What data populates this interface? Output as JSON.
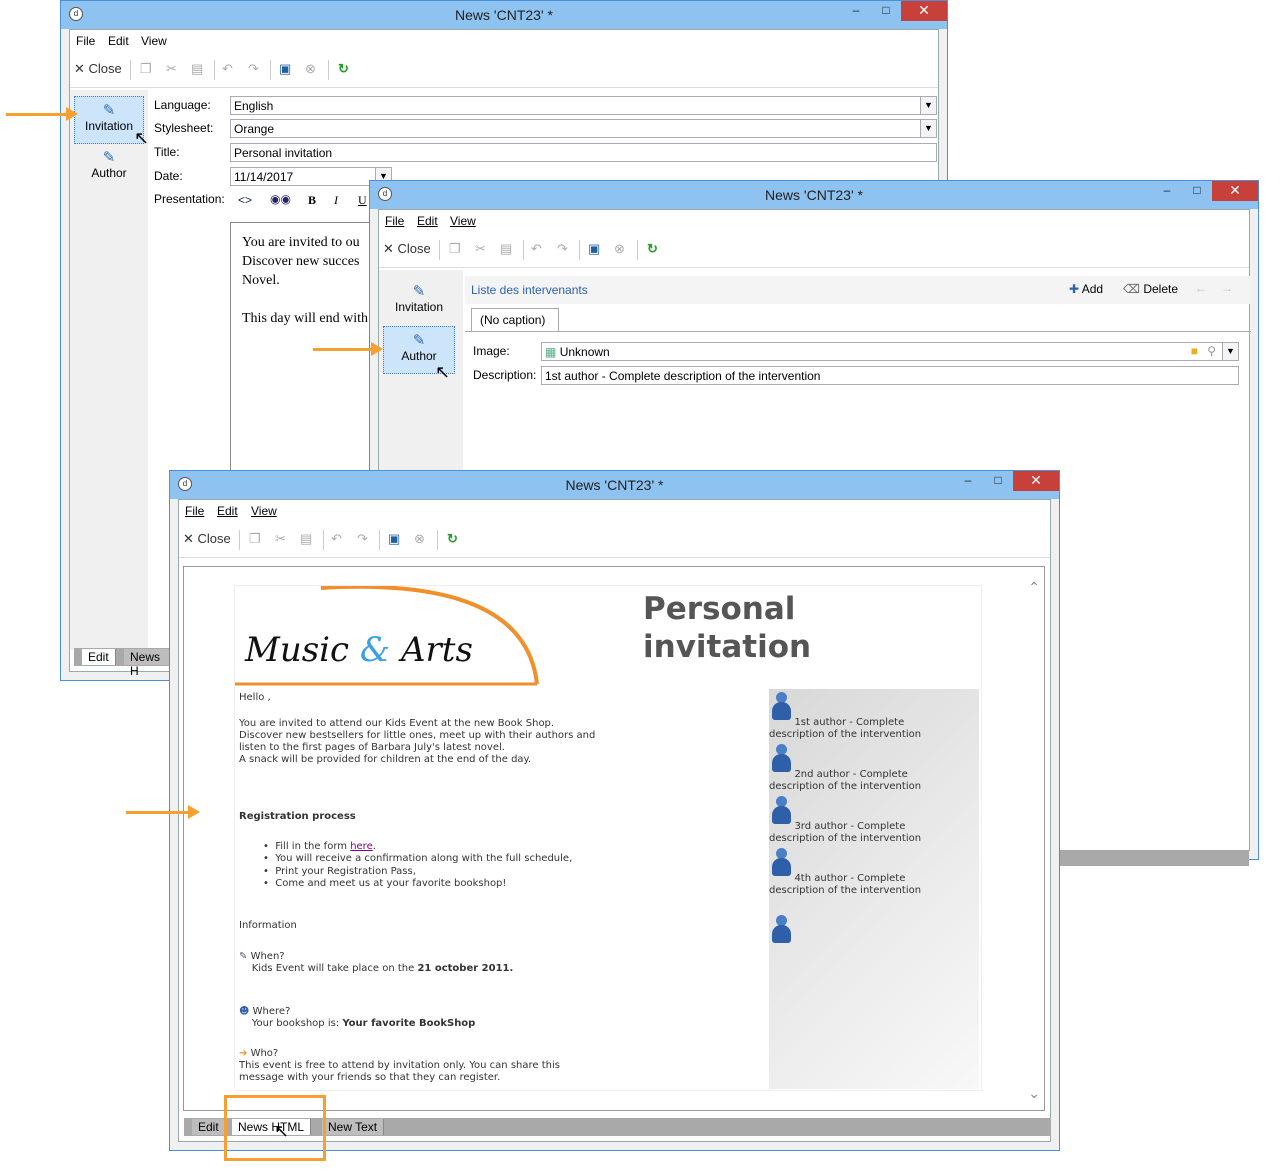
{
  "windows": {
    "back": {
      "title": "News 'CNT23' *",
      "menu": [
        "File",
        "Edit",
        "View"
      ],
      "close_label": "Close",
      "nav": [
        {
          "label": "Invitation"
        },
        {
          "label": "Author"
        }
      ],
      "fields": {
        "language_label": "Language:",
        "language_value": "English",
        "stylesheet_label": "Stylesheet:",
        "stylesheet_value": "Orange",
        "title_label": "Title:",
        "title_value": "Personal invitation",
        "date_label": "Date:",
        "date_value": "11/14/2017",
        "presentation_label": "Presentation:"
      },
      "editor_lines": [
        "You are invited to ou",
        "Discover new succes",
        "Novel.",
        "",
        "This day will end with"
      ],
      "tabs": [
        "Edit",
        "News H"
      ]
    },
    "middle": {
      "title": "News 'CNT23' *",
      "menu": [
        "File",
        "Edit",
        "View"
      ],
      "close_label": "Close",
      "nav": [
        {
          "label": "Invitation"
        },
        {
          "label": "Author"
        }
      ],
      "list_title": "Liste des intervenants",
      "add_label": "Add",
      "delete_label": "Delete",
      "caption_tab": "(No caption)",
      "image_label": "Image:",
      "image_value": "Unknown",
      "description_label": "Description:",
      "description_value": "1st author - Complete description of the intervention"
    },
    "front": {
      "title": "News 'CNT23' *",
      "menu": [
        "File",
        "Edit",
        "View"
      ],
      "close_label": "Close",
      "tabs": [
        "Edit",
        "News HTML",
        "New Text"
      ]
    }
  },
  "email": {
    "logo_text_1": "Music",
    "logo_amp": "&",
    "logo_text_2": "Arts",
    "heading_1": "Personal",
    "heading_2": "invitation",
    "hello": "Hello ,",
    "intro": [
      "You are invited to attend our Kids Event at the new Book Shop.",
      "Discover new bestsellers for little ones, meet up with their authors and",
      "listen to the first pages of Barbara July's latest novel.",
      "A snack will be provided for children at the end of the day."
    ],
    "registration_title": "Registration process",
    "registration_items": [
      "Fill in the form here.",
      "You will receive a confirmation along with the full schedule,",
      "Print your Registration Pass,",
      "Come and meet us at your favorite bookshop!"
    ],
    "form_link": "here",
    "information": "Information",
    "when_label": "When?",
    "when_text": "Kids Event will take place on the",
    "when_date": "21 october 2011.",
    "where_label": "Where?",
    "where_text": "Your bookshop is:",
    "where_value": "Your favorite BookShop",
    "who_label": "Who?",
    "who_text_1": "This event is free to attend by invitation only. You can share this",
    "who_text_2": "message with your friends so that they can register.",
    "authors": [
      {
        "line1": "1st author - Complete",
        "line2": "description of the intervention"
      },
      {
        "line1": "2nd author - Complete",
        "line2": "description of the intervention"
      },
      {
        "line1": "3rd author - Complete",
        "line2": "description of the intervention"
      },
      {
        "line1": "4th author - Complete",
        "line2": "description of the intervention"
      }
    ]
  },
  "colors": {
    "accent": "#f5a030",
    "titlebar": "#8ec2f0",
    "close": "#c7403a",
    "logo_amp": "#3aa0e0"
  }
}
